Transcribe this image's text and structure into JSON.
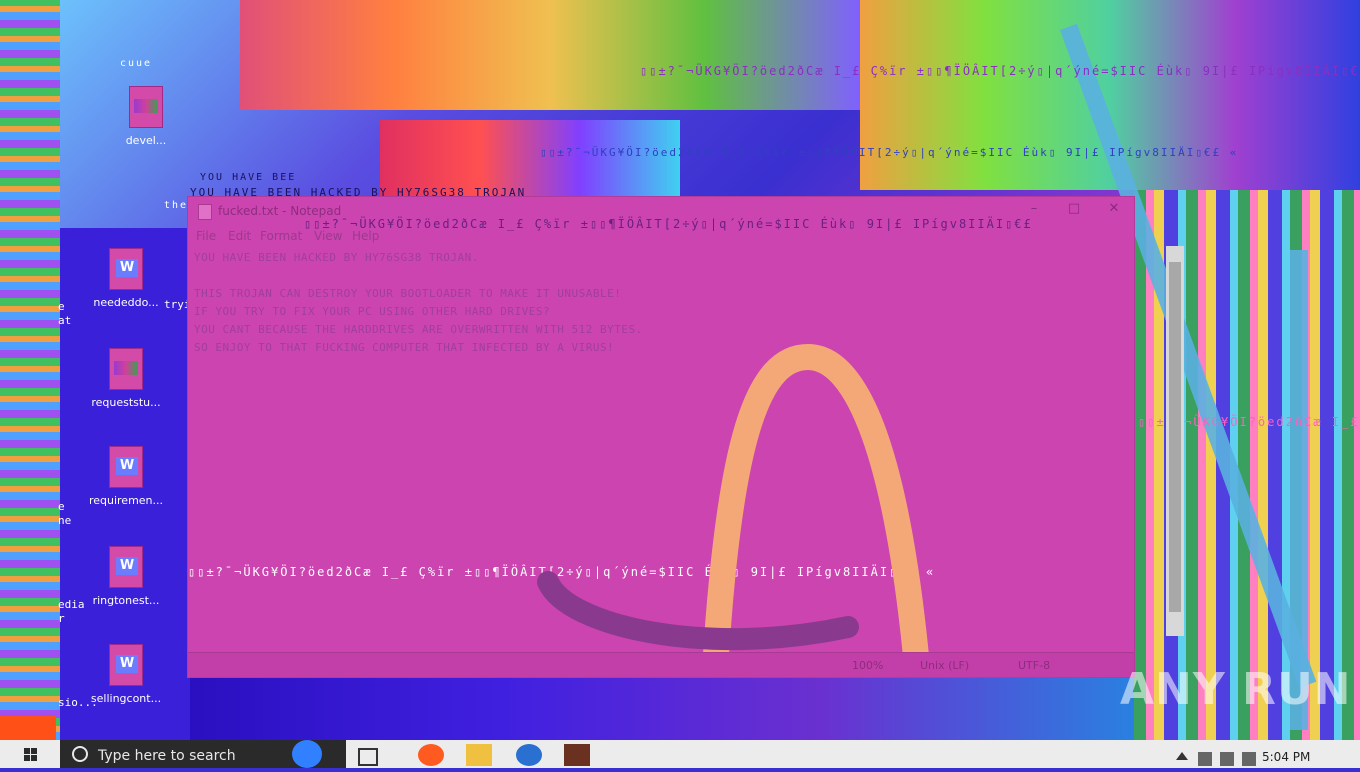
{
  "desktop": {
    "icons": [
      {
        "label": "neededdo..."
      },
      {
        "label": "requeststu..."
      },
      {
        "label": "requiremen..."
      },
      {
        "label": "ringtonest..."
      },
      {
        "label": "sellingcont..."
      }
    ],
    "top_icon_label": "devel...",
    "left_partial_labels": [
      "e",
      "at",
      "e",
      "ne",
      "edia",
      "r",
      "sio..."
    ],
    "col2_partial_label": "tryin",
    "top_misc": "cuue",
    "glitch_lines": [
      "YOU HAVE BEEN HACKED BY HY76SG38 TROJAN",
      "YOU HAVE BEE",
      "ther"
    ],
    "glitch_garbage": "▯▯±?¯¬ÜKG¥ÖI?öed2ðCæ I_£ Ç%ïr ±▯▯¶ÏÖÂIT[2÷ý▯|q´ýné=$IIC Éùk▯ 9I|£ IPígv8IIÄI▯€£ «"
  },
  "notepad": {
    "title": "fucked.txt - Notepad",
    "title_garbage": "▯▯±?¯¬ÜKG¥ÖI?öed2ðCæ I_£ Ç%ïr ±▯▯¶ÏÖÂIT[2÷ý▯|q´ýné=$IIC Éùk▯ 9I|£ IPígv8IIÄI▯€£",
    "menu": [
      "File",
      "Edit",
      "Format",
      "View",
      "Help"
    ],
    "lines": [
      "YOU HAVE BEEN HACKED BY HY76SG38 TROJAN.",
      "",
      "THIS TROJAN CAN DESTROY YOUR BOOTLOADER TO MAKE IT UNUSABLE!",
      "IF YOU TRY TO FIX YOUR PC USING OTHER HARD DRIVES?",
      "YOU CANT BECAUSE THE HARDDRIVES ARE OVERWRITTEN WITH 512 BYTES.",
      "SO ENJOY TO THAT FUCKING COMPUTER THAT INFECTED BY A VIRUS!"
    ],
    "garbage_line": "▯▯±?¯¬ÜKG¥ÖI?öed2ðCæ I_£ Ç%ïr ±▯▯¶ÏÖÂIT[2÷ý▯|q´ýné=$IIC Éùk▯ 9I|£ IPígv8IIÄI▯€£ «",
    "status": {
      "zoom": "100%",
      "line_ending": "Unix (LF)",
      "encoding": "UTF-8"
    }
  },
  "taskbar": {
    "search_placeholder": "Type here to search",
    "time": "5:04 PM"
  },
  "watermark": "ANY RUN",
  "colors": {
    "accent": "#cc44b0",
    "taskbar": "#ececec",
    "search": "#2a2a2a"
  }
}
